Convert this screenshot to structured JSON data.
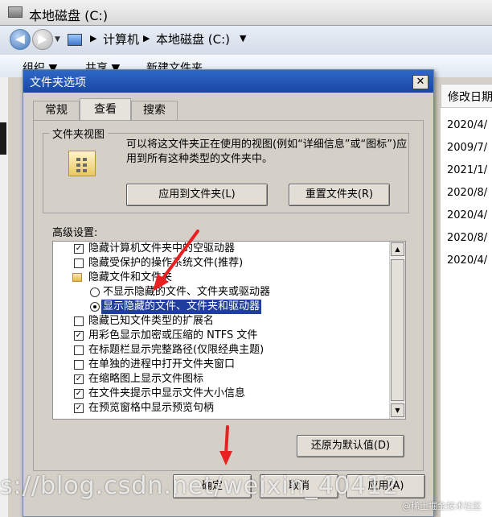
{
  "explorer": {
    "title": "本地磁盘 (C:)",
    "breadcrumb": [
      "计算机",
      "本地磁盘 (C:)"
    ],
    "toolbar": [
      "组织 ▼",
      "共享 ▼",
      "新建文件夹"
    ],
    "column_header": "修改日期",
    "dates": [
      "2020/4/",
      "2009/7/",
      "2021/1/",
      "2020/8/",
      "2020/4/",
      "2020/8/",
      "2020/4/"
    ]
  },
  "dialog": {
    "title": "文件夹选项",
    "close_label": "✕",
    "tabs": [
      "常规",
      "查看",
      "搜索"
    ],
    "group_title": "文件夹视图",
    "group_desc": "可以将这文件夹正在使用的视图(例如“详细信息”或“图标”)应用到所有这种类型的文件夹中。",
    "apply_to_folders": "应用到文件夹(L)",
    "reset_folders": "重置文件夹(R)",
    "advanced_label": "高级设置:",
    "settings": [
      {
        "type": "check",
        "checked": true,
        "label": "隐藏计算机文件夹中的空驱动器"
      },
      {
        "type": "check",
        "checked": false,
        "label": "隐藏受保护的操作系统文件(推荐)"
      },
      {
        "type": "folder",
        "label": "隐藏文件和文件夹"
      },
      {
        "type": "radio",
        "checked": false,
        "label": "不显示隐藏的文件、文件夹或驱动器"
      },
      {
        "type": "radio",
        "checked": true,
        "label": "显示隐藏的文件、文件夹和驱动器",
        "selected": true
      },
      {
        "type": "check",
        "checked": false,
        "label": "隐藏已知文件类型的扩展名"
      },
      {
        "type": "check",
        "checked": true,
        "label": "用彩色显示加密或压缩的 NTFS 文件"
      },
      {
        "type": "check",
        "checked": false,
        "label": "在标题栏显示完整路径(仅限经典主题)"
      },
      {
        "type": "check",
        "checked": false,
        "label": "在单独的进程中打开文件夹窗口"
      },
      {
        "type": "check",
        "checked": true,
        "label": "在缩略图上显示文件图标"
      },
      {
        "type": "check",
        "checked": true,
        "label": "在文件夹提示中显示文件大小信息"
      },
      {
        "type": "check",
        "checked": true,
        "label": "在预览窗格中显示预览句柄"
      }
    ],
    "restore_defaults": "还原为默认值(D)",
    "ok": "确定",
    "cancel": "取消",
    "apply": "应用(A)"
  },
  "watermark": "s://blog.csdn.net/weixin_40412",
  "watermark_small": "@稀土掘金技术社区",
  "colors": {
    "title_bar": "#1f52b4",
    "selection": "#1f3e9e",
    "annotation_arrow": "#e82222"
  },
  "icons": {
    "back": "back-arrow-icon",
    "forward": "forward-arrow-icon",
    "close": "close-icon",
    "folder": "folder-icon",
    "check": "checkbox-icon",
    "radio": "radio-icon"
  }
}
